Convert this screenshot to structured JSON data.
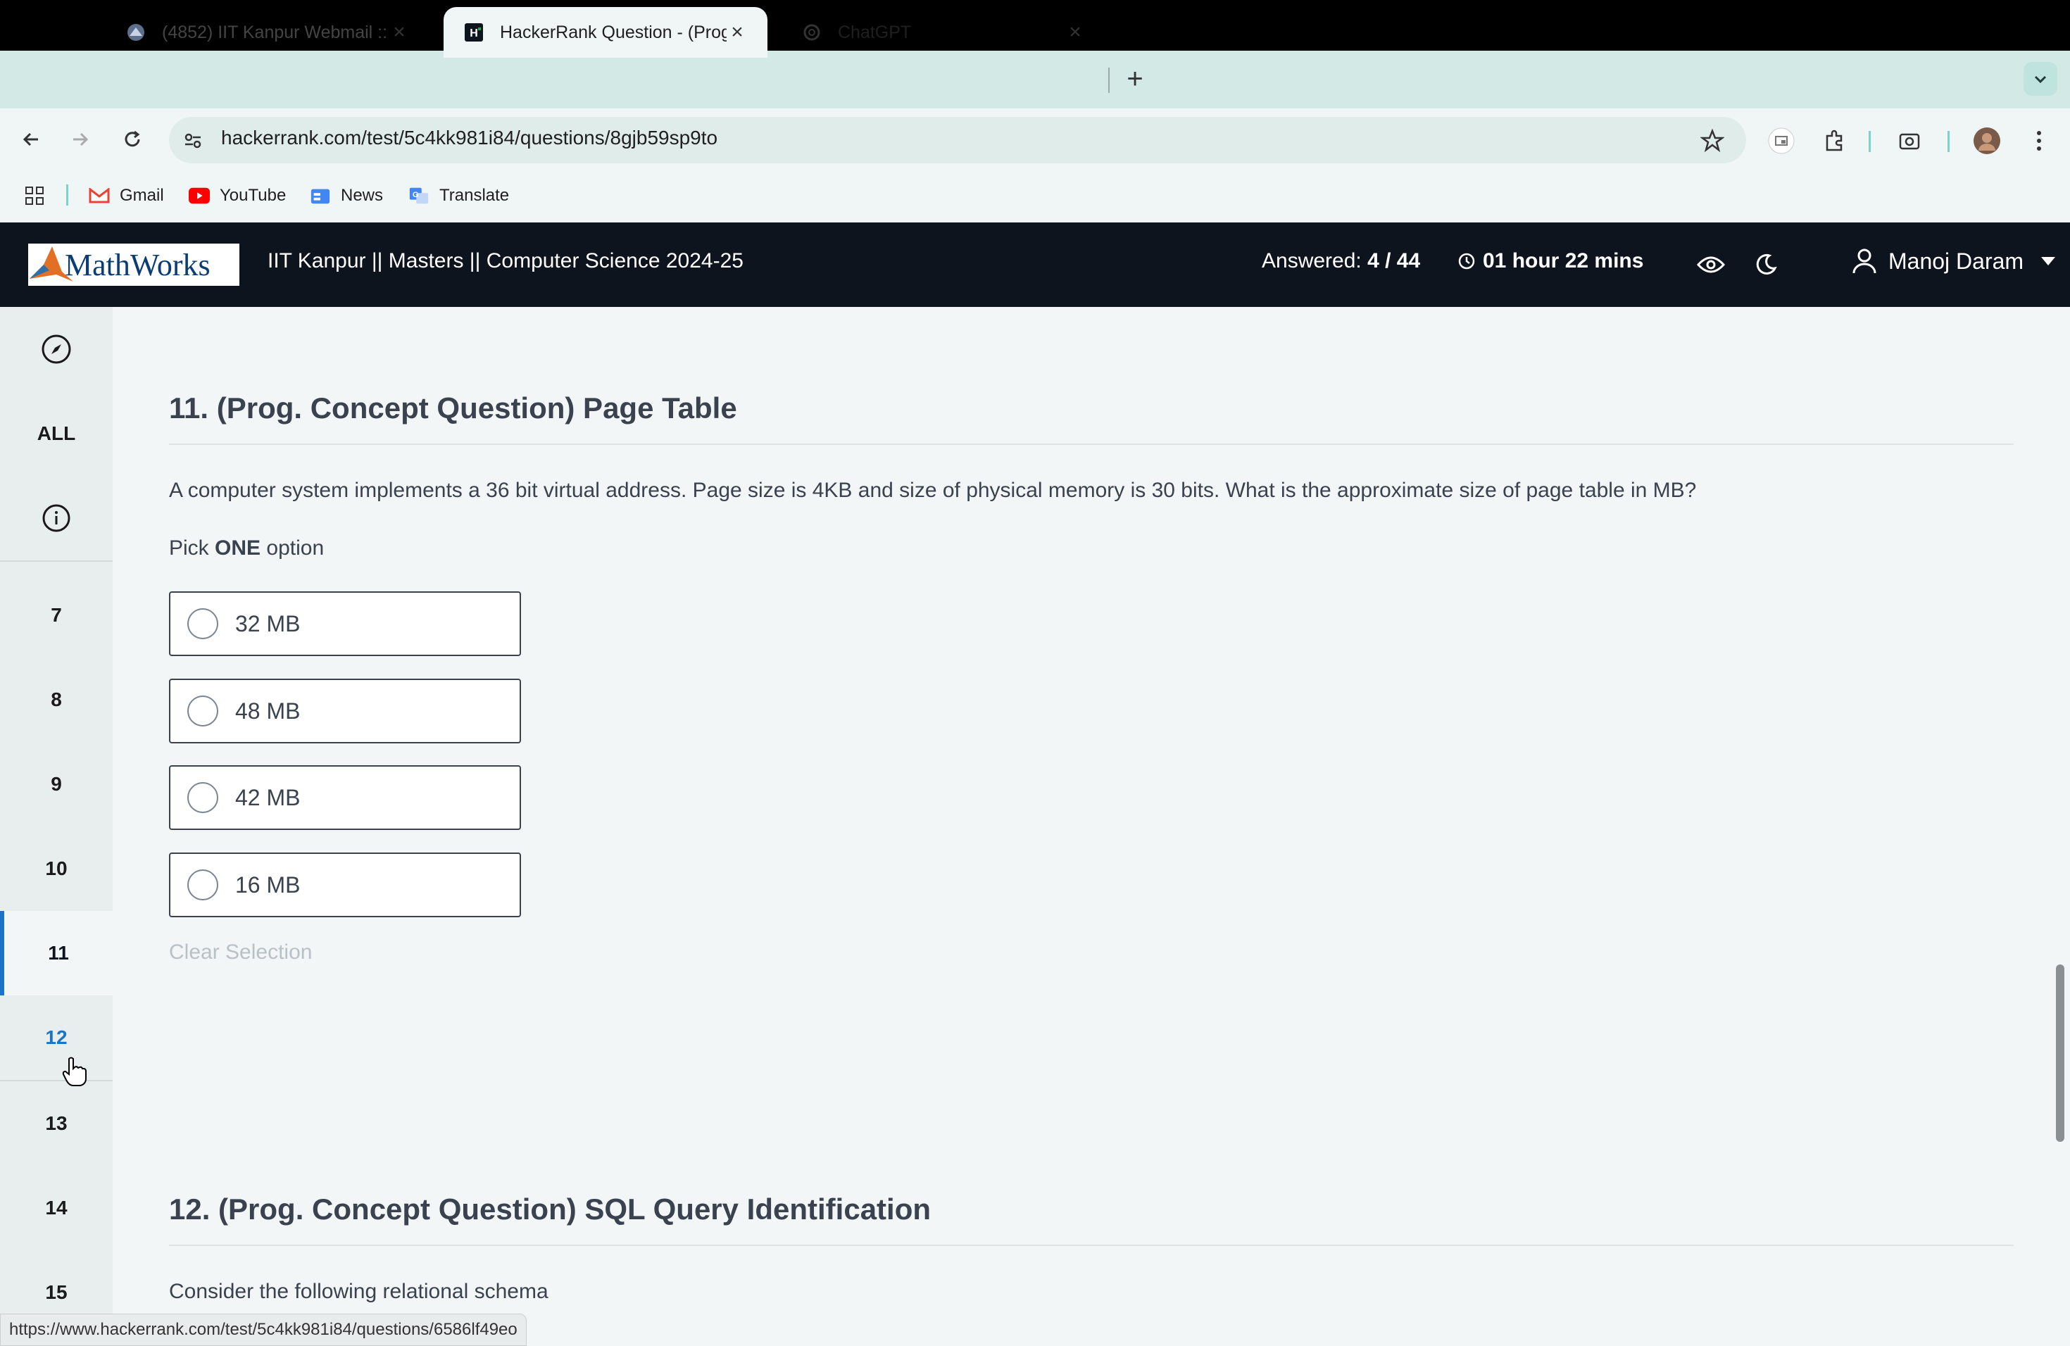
{
  "browser": {
    "tabs": [
      {
        "title": "(4852) IIT Kanpur Webmail ::",
        "favicon": "webmail-icon",
        "active": false
      },
      {
        "title": "HackerRank Question - (Prog",
        "favicon": "hackerrank-icon",
        "active": true
      },
      {
        "title": "ChatGPT",
        "favicon": "chatgpt-icon",
        "active": false
      }
    ],
    "url": "hackerrank.com/test/5c4kk981i84/questions/8gjb59sp9to",
    "bookmarks": [
      {
        "label": "Gmail",
        "icon": "gmail-icon"
      },
      {
        "label": "YouTube",
        "icon": "youtube-icon"
      },
      {
        "label": "News",
        "icon": "news-icon"
      },
      {
        "label": "Translate",
        "icon": "translate-icon"
      }
    ],
    "status_url": "https://www.hackerrank.com/test/5c4kk981i84/questions/6586lf49eo"
  },
  "header": {
    "logo_text": "MathWorks",
    "test_title": "IIT Kanpur || Masters || Computer Science 2024-25",
    "answered_label": "Answered:",
    "answered_value": "4 / 44",
    "timer": "01 hour 22 mins",
    "user_name": "Manoj Daram"
  },
  "sidebar": {
    "all_label": "ALL",
    "items": [
      "7",
      "8",
      "9",
      "10",
      "11",
      "12",
      "13",
      "14",
      "15"
    ],
    "active": "11"
  },
  "question11": {
    "title": "11. (Prog. Concept Question) Page Table",
    "body": "A computer system implements a 36 bit virtual address. Page size is 4KB and size of physical memory is 30 bits. What is the approximate size of page table in MB?",
    "pick_prefix": "Pick",
    "pick_bold": "ONE",
    "pick_suffix": "option",
    "options": [
      "32 MB",
      "48 MB",
      "42 MB",
      "16 MB"
    ],
    "clear_label": "Clear Selection"
  },
  "question12": {
    "title": "12. (Prog. Concept Question) SQL Query Identification",
    "body": "Consider the following relational schema"
  },
  "colors": {
    "header_bg": "#0e141e",
    "accent": "#1b74c4",
    "tabstrip": "#d3e9e6"
  }
}
